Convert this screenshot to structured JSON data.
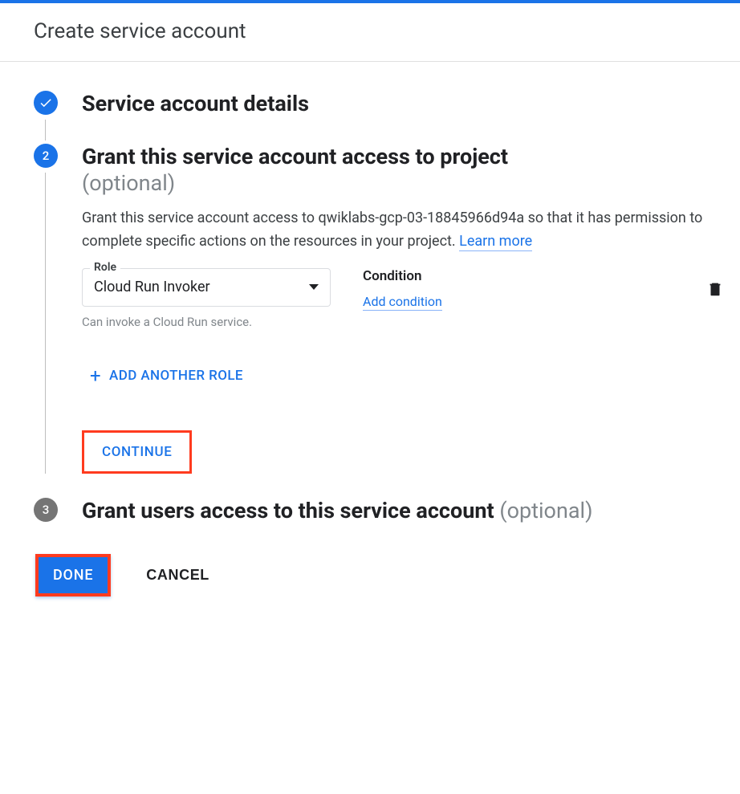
{
  "header": {
    "title": "Create service account"
  },
  "steps": {
    "one": {
      "title": "Service account details"
    },
    "two": {
      "number": "2",
      "title": "Grant this service account access to project",
      "optional": "(optional)",
      "desc_prefix": "Grant this service account access to ",
      "project_id": "qwiklabs-gcp-03-18845966d94a",
      "desc_suffix": " so that it has permission to complete specific actions on the resources in your project. ",
      "learn_more": "Learn more",
      "role_label": "Role",
      "role_value": "Cloud Run Invoker",
      "role_help": "Can invoke a Cloud Run service.",
      "condition_label": "Condition",
      "add_condition": "Add condition",
      "add_another_role": "ADD ANOTHER ROLE",
      "continue": "CONTINUE"
    },
    "three": {
      "number": "3",
      "title": "Grant users access to this service account",
      "optional": "(optional)"
    }
  },
  "footer": {
    "done": "DONE",
    "cancel": "CANCEL"
  }
}
